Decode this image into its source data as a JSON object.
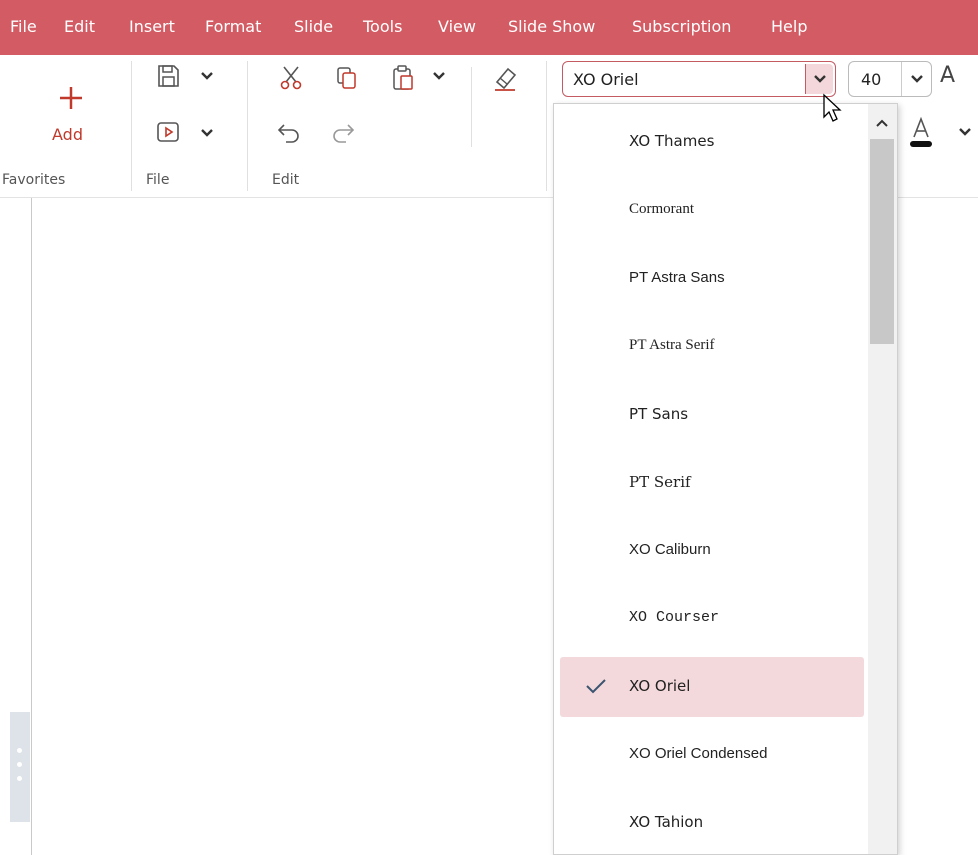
{
  "menu": {
    "items": [
      "File",
      "Edit",
      "Insert",
      "Format",
      "Slide",
      "Tools",
      "View",
      "Slide Show",
      "Subscription",
      "Help"
    ]
  },
  "ribbon": {
    "add_label": "Add",
    "groups": {
      "favorites": "Favorites",
      "file": "File",
      "edit": "Edit"
    },
    "font_name": "XO Oriel",
    "font_size": "40",
    "grow_font": "A"
  },
  "font_dropdown": {
    "options": [
      {
        "label": "XO Thames",
        "family": "\"DejaVu Sans\", sans-serif"
      },
      {
        "label": "Cormorant",
        "family": "\"Liberation Serif\", serif"
      },
      {
        "label": "PT Astra Sans",
        "family": "\"Liberation Sans\", sans-serif"
      },
      {
        "label": "PT Astra Serif",
        "family": "\"Liberation Serif\", serif"
      },
      {
        "label": "PT Sans",
        "family": "\"DejaVu Sans\", sans-serif"
      },
      {
        "label": "PT Serif",
        "family": "\"DejaVu Serif\", serif"
      },
      {
        "label": "XO Caliburn",
        "family": "\"Liberation Sans\", sans-serif"
      },
      {
        "label": "XO Courser",
        "family": "\"Liberation Mono\", monospace"
      },
      {
        "label": "XO Oriel",
        "family": "\"DejaVu Sans\", sans-serif"
      },
      {
        "label": "XO Oriel Condensed",
        "family": "\"Liberation Sans\", sans-serif"
      },
      {
        "label": "XO Tahion",
        "family": "\"DejaVu Sans\", sans-serif"
      }
    ],
    "selected": "XO Oriel"
  },
  "colors": {
    "accent": "#d35c64",
    "selected_bg": "#f3d9dc"
  }
}
